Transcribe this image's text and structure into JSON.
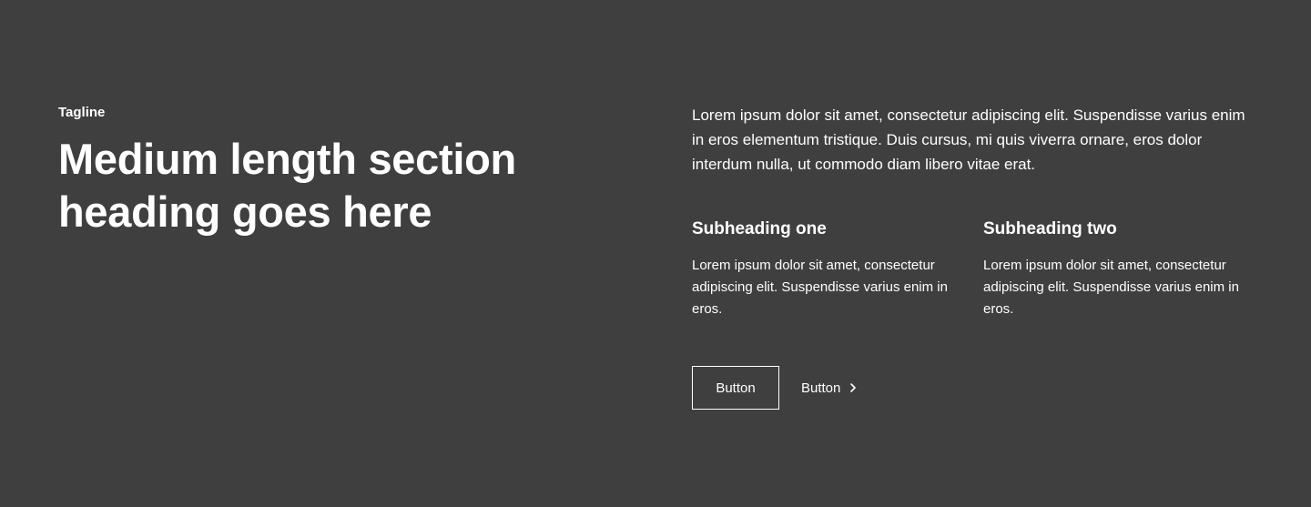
{
  "colors": {
    "background": "#3f3f3f",
    "text": "#ffffff"
  },
  "left": {
    "tagline": "Tagline",
    "heading_line1": "Medium length section",
    "heading_line2": "heading goes here"
  },
  "right": {
    "intro": "Lorem ipsum dolor sit amet, consectetur adipiscing elit. Suspendisse varius enim in eros elementum tristique. Duis cursus, mi quis viverra ornare, eros dolor interdum nulla, ut commodo diam libero vitae erat.",
    "columns": [
      {
        "subheading": "Subheading one",
        "text": "Lorem ipsum dolor sit amet, consectetur adipiscing elit. Suspendisse varius enim in eros."
      },
      {
        "subheading": "Subheading two",
        "text": "Lorem ipsum dolor sit amet, consectetur adipiscing elit. Suspendisse varius enim in eros."
      }
    ],
    "buttons": {
      "primary_label": "Button",
      "secondary_label": "Button",
      "secondary_icon": "chevron-right-icon"
    }
  }
}
